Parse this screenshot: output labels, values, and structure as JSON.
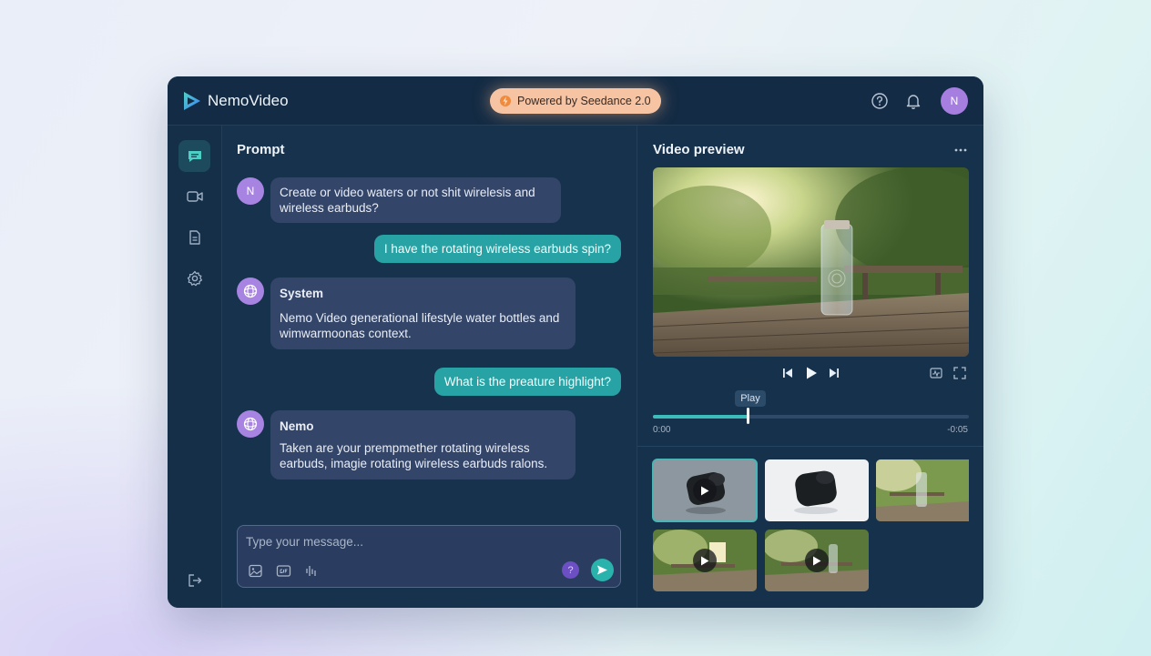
{
  "app": {
    "title": "NemoVideo",
    "badge": "Powered by Seedance 2.0",
    "user_initial": "N"
  },
  "colors": {
    "accent": "#27a3a5",
    "badge_bg": "#f6c4a2",
    "avatar": "#a57ee0",
    "window_bg": "#15304a"
  },
  "header_icons": [
    "help-circle-icon",
    "bell-icon"
  ],
  "sidebar": {
    "items": [
      {
        "icon": "chat-icon",
        "active": true
      },
      {
        "icon": "video-icon",
        "active": false
      },
      {
        "icon": "document-icon",
        "active": false
      },
      {
        "icon": "gear-icon",
        "active": false
      }
    ],
    "bottom_icon": "logout-icon"
  },
  "chat": {
    "title": "Prompt",
    "messages": [
      {
        "role": "user",
        "avatar": "N",
        "text": "Create or video waters or not shit wirelesis and wireless earbuds?"
      },
      {
        "role": "me",
        "text": "I have the rotating wireless earbuds spin?"
      },
      {
        "role": "system",
        "name": "System",
        "text": "Nemo Video generational lifestyle water bottles and wimwarmoonas context."
      },
      {
        "role": "me",
        "text": "What is the preature highlight?"
      },
      {
        "role": "system",
        "name": "Nemo",
        "text": "Taken are your prempmether rotating wireless earbuds, imagie rotating wireless earbuds ralons."
      }
    ],
    "composer": {
      "placeholder": "Type your message...",
      "value": "",
      "help_label": "?",
      "tools": [
        "image-icon",
        "gif-icon",
        "audio-waveform-icon"
      ]
    }
  },
  "preview": {
    "title": "Video preview",
    "tooltip": "Play",
    "time_current": "0:00",
    "time_remaining": "-0:05",
    "progress": 0.3,
    "controls": [
      "skip-back-icon",
      "play-icon",
      "skip-forward-icon"
    ],
    "extra_controls": [
      "waveform-icon",
      "fullscreen-icon"
    ],
    "thumbnails": [
      {
        "subject": "earbuds case",
        "selected": true,
        "playable": true
      },
      {
        "subject": "earbuds case",
        "selected": false,
        "playable": false
      },
      {
        "subject": "water bottle on table",
        "selected": false,
        "playable": false
      },
      {
        "subject": "water bottle on table",
        "selected": false,
        "playable": true
      },
      {
        "subject": "water bottle on table",
        "selected": false,
        "playable": true
      }
    ]
  }
}
